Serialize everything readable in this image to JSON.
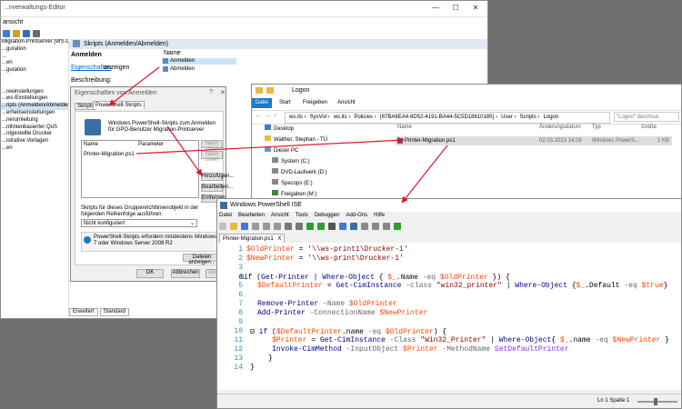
{
  "gpe": {
    "title": "...nverwaltungs-Editor",
    "menu": "ansicht",
    "tree": [
      "Migration-Printserver [WS-DC1.",
      "...guration",
      "...",
      "...en",
      "...guration",
      "",
      "",
      "...reeinstellungen",
      "...ws-Einstellungen",
      "...ripts (Anmelden/Abmelden)",
      "...erheitseinstellungen",
      "...nerumleitung",
      "...ntlinienbasierter QoS",
      "...ntgestellte Drucker",
      "...istrative Vorlagen",
      "...en"
    ],
    "selected_index": 9,
    "header": "Skripts (Anmelden/Abmelden)",
    "left_heading": "Anmelden",
    "props_link": "Eigenschaften",
    "props_suffix": "anzeigen",
    "beschreibung": "Beschreibung:",
    "name_col": "Name",
    "items": [
      "Anmelden",
      "Abmelden"
    ],
    "tabs": [
      "Erweitert",
      "Standard"
    ]
  },
  "props": {
    "title": "Eigenschaften von Anmelden",
    "help": "?",
    "close": "✕",
    "tabs": [
      "Skripts",
      "PowerShell-Skripts"
    ],
    "desc": "Windows PowerShell-Skripts zum Anmelden für GPO-Benutzer Migration-Printserver",
    "col_name": "Name",
    "col_params": "Parameter",
    "row_name": "Printer-Migration.ps1",
    "btn_up": "Nach oben",
    "btn_down": "Nach unten",
    "btn_add": "Hinzufügen...",
    "btn_edit": "Bearbeiten...",
    "btn_remove": "Entfernen",
    "order_label": "Skripts für dieses Gruppenrichtlinienobjekt in der folgenden Reihenfolge ausführen:",
    "order_value": "Nicht konfiguriert",
    "info": "PowerShell-Skripts erfordern mindestens Windows 7 oder Windows Server 2008 R2",
    "btn_show": "Dateien anzeigen...",
    "btn_ok": "OK",
    "btn_cancel": "Abbrechen",
    "btn_apply": "Über..."
  },
  "explorer": {
    "title": "Logon",
    "ribbon": [
      "Datei",
      "Start",
      "Freigeben",
      "Ansicht"
    ],
    "path": [
      "ws.its",
      "SysVol",
      "ws.its",
      "Policies",
      "{67BA6EA4-8D52-4191-BA44-5C5D18610185}",
      "User",
      "Scripts",
      "Logon"
    ],
    "search": "\"Logon\" durchsuc",
    "nav": [
      "Desktop",
      "Walther, Stephan - TÜ",
      "Dieser PC",
      "System (C:)",
      "DVD-Laufwerk (D:)",
      "Specops (E:)",
      "Freigaben (M:)"
    ],
    "cols": [
      "Name",
      "Änderungsdatum",
      "Typ",
      "Größe"
    ],
    "file": {
      "name": "Printer-Migration.ps1",
      "date": "02.03.2023 14:28",
      "type": "Windows PowerS...",
      "size": "1 KB"
    }
  },
  "ise": {
    "title": "Windows PowerShell ISE",
    "menu": [
      "Datei",
      "Bearbeiten",
      "Ansicht",
      "Tools",
      "Debuggen",
      "Add-Ons",
      "Hilfe"
    ],
    "tab": "Printer-Migration.ps1",
    "tab_close": "X",
    "status": "Ln 1  Spalte 1",
    "zoom": "100%"
  },
  "colors": {
    "accent": "#1979ca",
    "arrow": "#e0162b"
  }
}
